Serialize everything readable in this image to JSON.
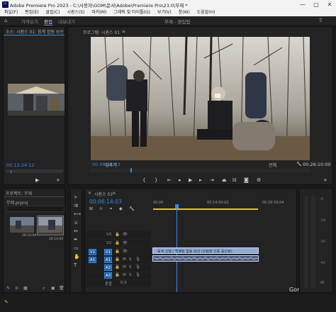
{
  "window": {
    "title": "Adobe Premiere Pro 2023 - C:\\사용자\\GOM\\문서\\Adobe\\Premiere Pro\\23.0\\무제 *",
    "app_icon": "Pr",
    "minimize": "—",
    "maximize": "□",
    "close": "✕"
  },
  "menu": [
    "파일(F)",
    "편집(E)",
    "클립(C)",
    "시퀀스(S)",
    "마커(M)",
    "그래픽 및 타이틀(G)",
    "보기(V)",
    "창(W)",
    "도움말(H)"
  ],
  "workspace": {
    "tabs": [
      "가져오기",
      "편집",
      "내보내기"
    ],
    "active": 1,
    "center_label": "무제 - 편집됨"
  },
  "source_panel": {
    "tab": "소스: 시퀀스 01: 음계 합동 보산",
    "timecode": "00:12:24:12"
  },
  "program_monitor": {
    "tab": "프로그램: 시퀀스 01",
    "timecode": "00:06:14:03",
    "fit": "맞추기",
    "quality": "전체",
    "duration": "00:26:10:00"
  },
  "project_panel": {
    "tab": "프로젝트: 무제",
    "file": "무제.prproj",
    "items": [
      {
        "name": "",
        "duration": "26:10:00"
      },
      {
        "name": "",
        "duration": "26:10:00"
      }
    ]
  },
  "timeline": {
    "tab": "시퀀스 01",
    "timecode": "00:06:14:03",
    "ruler": [
      "00:00",
      "00:14:59:02",
      "00:29:59:04"
    ],
    "video_tracks": [
      "V3",
      "V2",
      "V1"
    ],
    "audio_tracks": [
      "A1",
      "A2",
      "A3"
    ],
    "master": "혼합",
    "master_value": "0.0",
    "clip_title": "동계 산행 / 백패킹 합동 보산 (산림청 인증 등산로)"
  },
  "watermark": "Gomdora",
  "colors": {
    "accent": "#2d8ceb",
    "work_area": "#e8c31e",
    "clip": "#8fa9d4"
  }
}
